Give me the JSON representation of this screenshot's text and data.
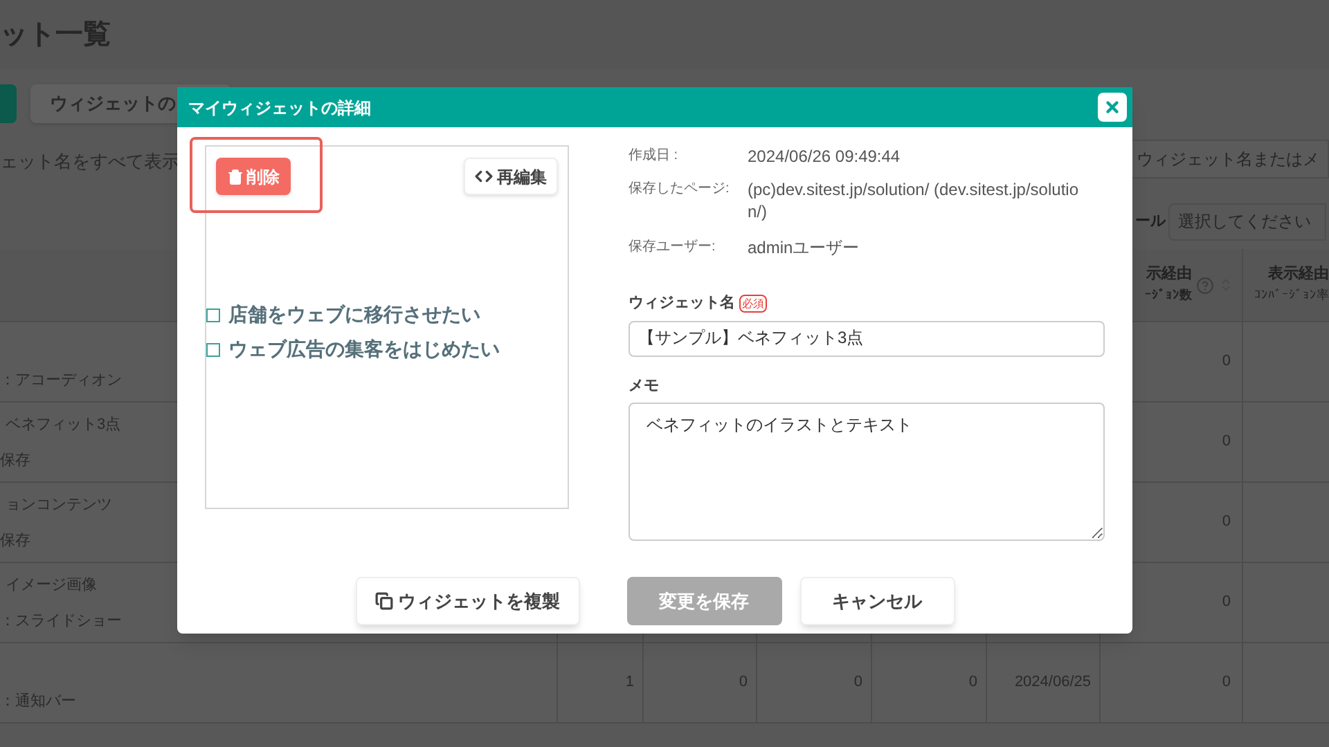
{
  "page_title": "ット一覧",
  "toolbar": {
    "button": "ウィジェットの"
  },
  "show_all_label": "ェット名をすべて表示",
  "search": {
    "placeholder": "ウィジェット名またはメ"
  },
  "filter": {
    "label": "ール",
    "placeholder": "選択してください"
  },
  "table": {
    "columns": [
      {
        "title": "示経由",
        "subtitle": "ｰｼﾞｮﾝ数"
      },
      {
        "title": "表示経由",
        "subtitle": "ｺﾝﾊﾞｰｼﾞｮﾝ率"
      }
    ],
    "rows": [
      {
        "line2": "：アコーディオン",
        "conversions": "0"
      },
      {
        "line1": "ベネフィット3点",
        "line2": "保存",
        "conversions": "0"
      },
      {
        "line1": "ョンコンテンツ",
        "line2": "保存",
        "conversions": "0"
      },
      {
        "line1": "イメージ画像",
        "line2": "：スライドショー",
        "conversions": "0"
      },
      {
        "line2": "：通知バー",
        "values": [
          "1",
          "0",
          "0",
          "0",
          "2024/06/25"
        ],
        "conversions": "0"
      }
    ]
  },
  "modal": {
    "title": "マイウィジェットの詳細",
    "delete_button": "削除",
    "reedit_button": "再編集",
    "preview_items": [
      "店舗をウェブに移行させたい",
      "ウェブ広告の集客をはじめたい"
    ],
    "info": [
      {
        "label": "作成日 :",
        "value": "2024/06/26 09:49:44"
      },
      {
        "label": "保存したページ:",
        "value": "(pc)dev.sitest.jp/solution/ (dev.sitest.jp/solution/)"
      },
      {
        "label": "保存ユーザー:",
        "value": "adminユーザー"
      }
    ],
    "name_label": "ウィジェット名",
    "required_badge": "必須",
    "name_value": "【サンプル】ベネフィット3点",
    "memo_label": "メモ",
    "memo_value": "ベネフィットのイラストとテキスト",
    "duplicate_button": "ウィジェットを複製",
    "save_button": {
      "label": "変更を保存",
      "disabled": true
    },
    "cancel_button": "キャンセル"
  }
}
